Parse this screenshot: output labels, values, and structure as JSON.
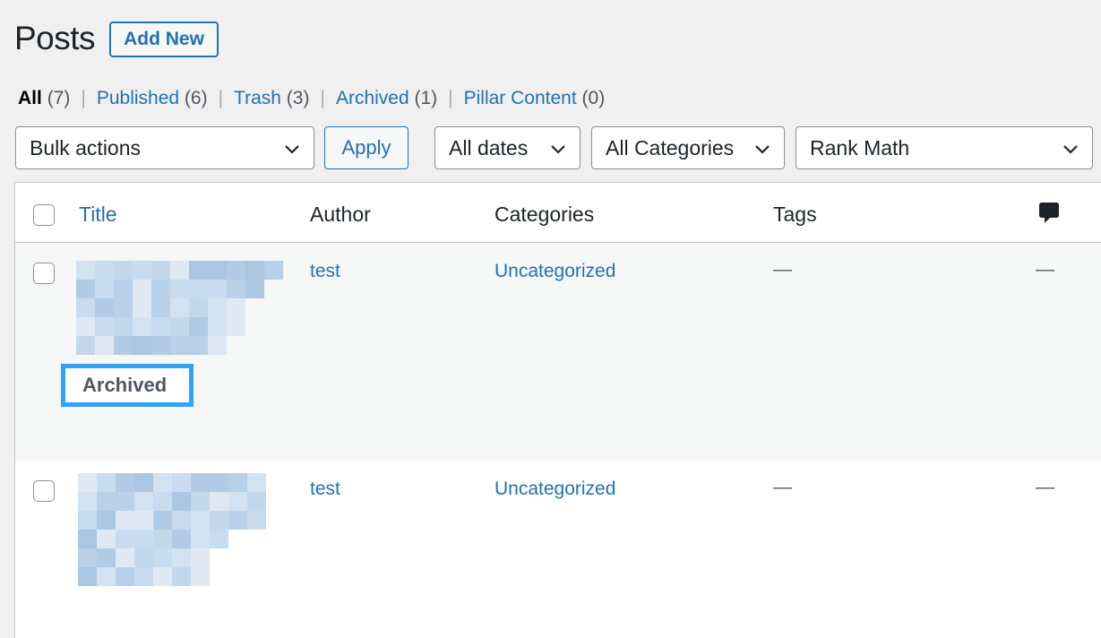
{
  "page": {
    "title": "Posts",
    "add_new_label": "Add New"
  },
  "views": [
    {
      "label": "All",
      "count": "(7)",
      "current": true
    },
    {
      "label": "Published",
      "count": "(6)"
    },
    {
      "label": "Trash",
      "count": "(3)"
    },
    {
      "label": "Archived",
      "count": "(1)"
    },
    {
      "label": "Pillar Content",
      "count": "(0)"
    }
  ],
  "filters": {
    "bulk_actions": "Bulk actions",
    "apply_label": "Apply",
    "dates": "All dates",
    "categories": "All Categories",
    "seo": "Rank Math"
  },
  "table": {
    "columns": {
      "title": "Title",
      "author": "Author",
      "categories": "Categories",
      "tags": "Tags",
      "comments_icon": "comment-bubble-icon"
    },
    "rows": [
      {
        "author": "test",
        "category": "Uncategorized",
        "tags": "—",
        "comments": "—",
        "state": "Archived",
        "title_redacted": true
      },
      {
        "author": "test",
        "category": "Uncategorized",
        "tags": "—",
        "comments": "—",
        "title_redacted": true
      }
    ]
  },
  "colors": {
    "link": "#2271b1",
    "highlight_border": "#32a3f4",
    "background": "#f0f0f1"
  }
}
